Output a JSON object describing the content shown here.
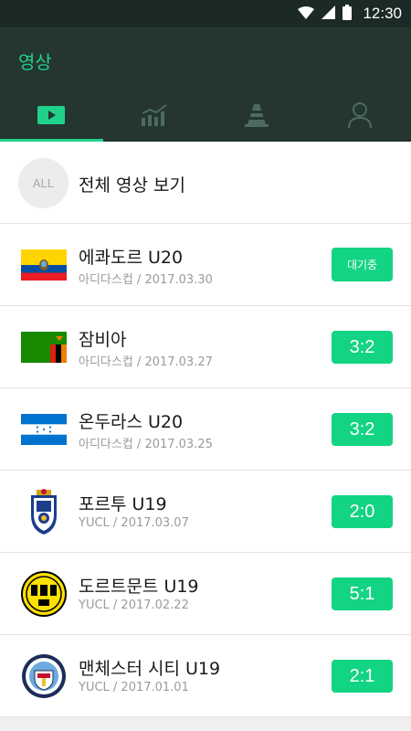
{
  "status_bar": {
    "time": "12:30"
  },
  "app_bar": {
    "title": "영상"
  },
  "tabs": [
    {
      "icon": "video-icon",
      "active": true
    },
    {
      "icon": "stats-icon",
      "active": false
    },
    {
      "icon": "cone-icon",
      "active": false
    },
    {
      "icon": "profile-icon",
      "active": false
    }
  ],
  "all_videos": {
    "badge": "ALL",
    "label": "전체 영상 보기"
  },
  "matches": [
    {
      "team": "에콰도르 U20",
      "meta": "아디다스컵 / 2017.03.30",
      "result": "대기중",
      "badge": "ecuador-flag"
    },
    {
      "team": "잠비아",
      "meta": "아디다스컵 / 2017.03.27",
      "result": "3:2",
      "badge": "zambia-flag"
    },
    {
      "team": "온두라스 U20",
      "meta": "아디다스컵 / 2017.03.25",
      "result": "3:2",
      "badge": "honduras-flag"
    },
    {
      "team": "포르투 U19",
      "meta": "YUCL / 2017.03.07",
      "result": "2:0",
      "badge": "porto-crest"
    },
    {
      "team": "도르트문트 U19",
      "meta": "YUCL / 2017.02.22",
      "result": "5:1",
      "badge": "dortmund-crest"
    },
    {
      "team": "맨체스터 시티 U19",
      "meta": "YUCL / 2017.01.01",
      "result": "2:1",
      "badge": "man-city-crest"
    }
  ],
  "colors": {
    "accent": "#13d482",
    "header": "#253530",
    "status_bar": "#1b2a26"
  }
}
